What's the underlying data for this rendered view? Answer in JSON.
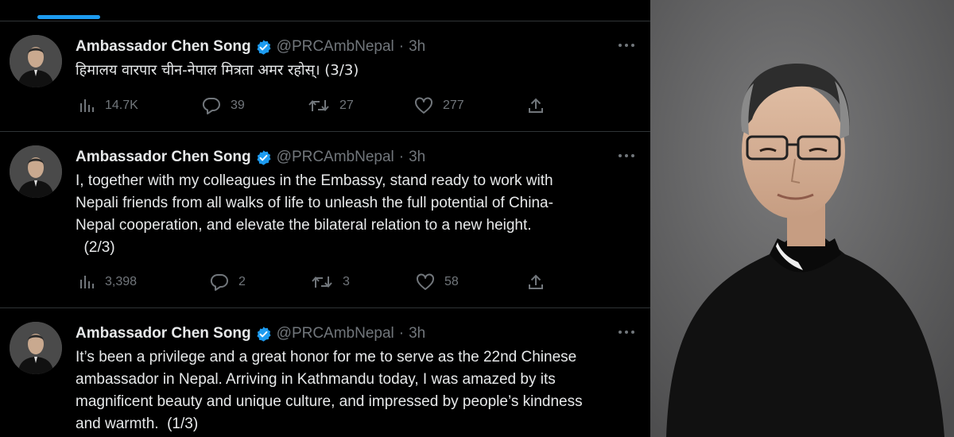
{
  "tweets": [
    {
      "author": "Ambassador Chen Song",
      "handle": "@PRCAmbNepal",
      "separator": "·",
      "time": "3h",
      "lines": [
        "हिमालय वारपार चीन-नेपाल मित्रता अमर रहोस्।  (3/3)"
      ],
      "stats": {
        "views": "14.7K",
        "replies": "39",
        "retweets": "27",
        "likes": "277"
      }
    },
    {
      "author": "Ambassador Chen Song",
      "handle": "@PRCAmbNepal",
      "separator": "·",
      "time": "3h",
      "lines": [
        "I, together with my colleagues in the Embassy, stand ready to work with",
        "Nepali friends from all walks of life to unleash the full potential of China-",
        "Nepal cooperation, and elevate the bilateral relation to a new height.",
        "  (2/3)"
      ],
      "stats": {
        "views": "3,398",
        "replies": "2",
        "retweets": "3",
        "likes": "58"
      }
    },
    {
      "author": "Ambassador Chen Song",
      "handle": "@PRCAmbNepal",
      "separator": "·",
      "time": "3h",
      "lines": [
        "It’s been a privilege and a great honor for me to serve as the 22nd Chinese",
        "ambassador in Nepal. Arriving in Kathmandu today, I was amazed by its",
        "magnificent beauty and unique culture, and impressed by people’s kindness",
        "and warmth.  (1/3)"
      ]
    }
  ],
  "icons": {
    "verified": "verified-badge-icon",
    "more": "more-dots-icon",
    "views": "bar-chart-icon",
    "reply": "speech-bubble-icon",
    "retweet": "retweet-arrows-icon",
    "like": "heart-icon",
    "share": "share-upload-icon"
  },
  "colors": {
    "background": "#000000",
    "text": "#e7e9ea",
    "muted": "#71767b",
    "accent": "#1d9bf0",
    "divider": "#2f3336"
  }
}
